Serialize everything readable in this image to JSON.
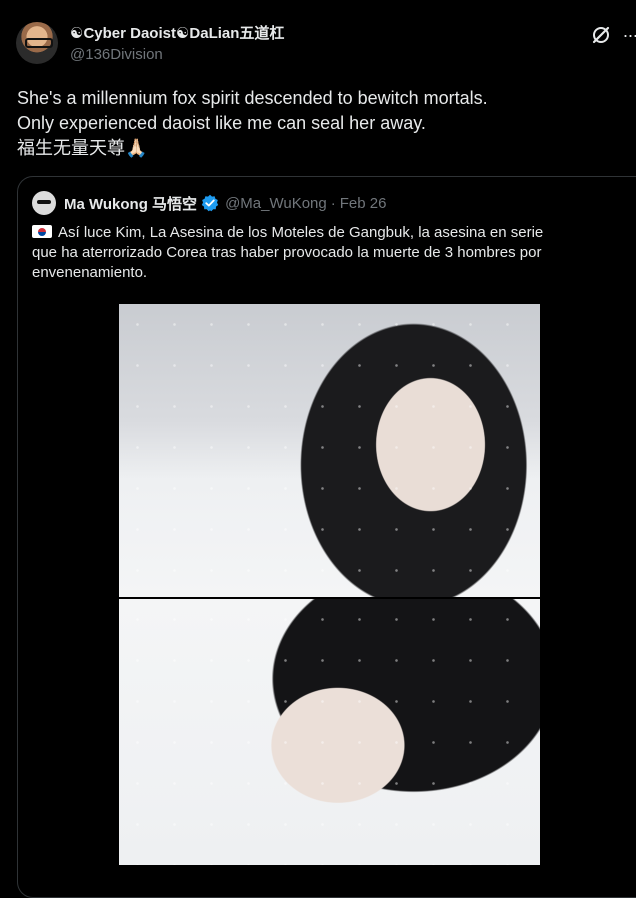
{
  "post": {
    "author": {
      "display_name": "☯Cyber Daoist☯DaLian五道杠",
      "handle": "@136Division",
      "avatar_icon": "avatar-photo"
    },
    "text_lines": [
      "She's a millennium fox spirit descended to bewitch mortals.",
      "Only experienced daoist like me can seal her away.",
      "福生无量天尊🙏🏻"
    ],
    "actions": {
      "grok_icon": "grok-icon",
      "more_icon": "more-icon",
      "more_label": "···"
    }
  },
  "quoted": {
    "author": {
      "display_name": "Ma Wukong 马悟空",
      "handle": "@Ma_WuKong",
      "separator": "·",
      "date": "Feb 26",
      "verified": true
    },
    "flag_icon": "south-korea-flag-icon",
    "text_lines": [
      "Así luce Kim, La Asesina de los Moteles de Gangbuk, la asesina en serie",
      "que ha aterrorizado Corea tras haber provocado la muerte de 3 hombres por",
      "envenenamiento."
    ],
    "images": [
      {
        "name": "photo-woman-snow-1"
      },
      {
        "name": "photo-woman-snow-2"
      }
    ]
  },
  "colors": {
    "background": "#000000",
    "text": "#e7e9ea",
    "secondary_text": "#71767b",
    "border": "#2f3336",
    "verified_blue": "#1d9bf0"
  }
}
